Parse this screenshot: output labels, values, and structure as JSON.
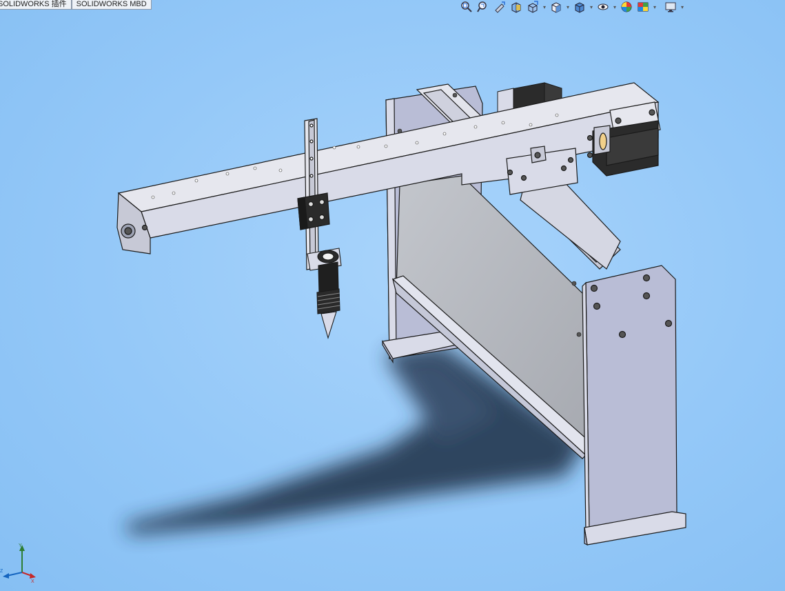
{
  "tabs": [
    {
      "label": "SOLIDWORKS 插件"
    },
    {
      "label": "SOLIDWORKS MBD"
    }
  ],
  "heads_up_toolbar": {
    "buttons": [
      {
        "icon": "zoom-to-fit-icon",
        "has_dropdown": false
      },
      {
        "icon": "zoom-to-area-icon",
        "has_dropdown": false
      },
      {
        "icon": "previous-view-icon",
        "has_dropdown": false
      },
      {
        "icon": "section-view-icon",
        "has_dropdown": false
      },
      {
        "icon": "dynamic-annotation-views-icon",
        "has_dropdown": true
      },
      {
        "icon": "view-orientation-icon",
        "has_dropdown": true
      },
      {
        "icon": "display-style-icon",
        "has_dropdown": true
      },
      {
        "icon": "hide-show-items-icon",
        "has_dropdown": true
      },
      {
        "icon": "edit-appearance-icon",
        "has_dropdown": false
      },
      {
        "icon": "apply-scene-icon",
        "has_dropdown": true
      },
      {
        "icon": "view-settings-icon",
        "has_dropdown": true
      }
    ]
  },
  "colors": {
    "background": "#94c8f8",
    "part_face": "#d9dbe8",
    "part_edge": "#1a1a1a",
    "plate_face": "#b9bdd6",
    "motor_dark": "#2b2b2b",
    "shadow": "#1e2f44"
  },
  "triad": {
    "x_label": "X",
    "y_label": "Y",
    "z_label": "Z"
  }
}
